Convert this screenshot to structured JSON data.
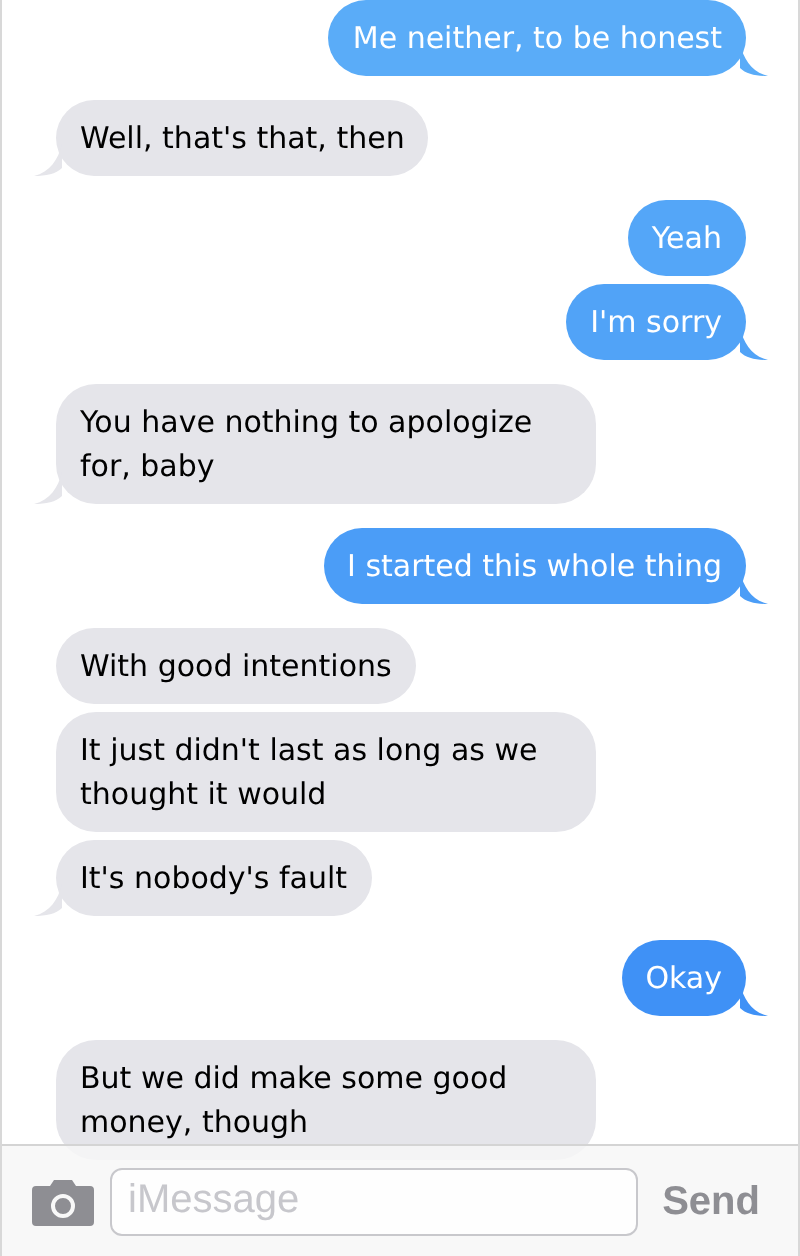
{
  "messages": [
    {
      "text": "Me neither, to be honest",
      "sent": true,
      "tail": true
    },
    {
      "text": "Well, that's that, then",
      "sent": false,
      "tail": true
    },
    {
      "text": "Yeah",
      "sent": true,
      "tail": false
    },
    {
      "text": "I'm sorry",
      "sent": true,
      "tail": true
    },
    {
      "text": "You have nothing to apologize for, baby",
      "sent": false,
      "tail": true
    },
    {
      "text": "I started this whole thing",
      "sent": true,
      "tail": true
    },
    {
      "text": "With good intentions",
      "sent": false,
      "tail": false
    },
    {
      "text": "It just didn't last as long as we thought it would",
      "sent": false,
      "tail": false
    },
    {
      "text": "It's nobody's fault",
      "sent": false,
      "tail": true
    },
    {
      "text": "Okay",
      "sent": true,
      "tail": true
    },
    {
      "text": "But we did make some good money, though",
      "sent": false,
      "tail": false
    }
  ],
  "composer": {
    "placeholder": "iMessage",
    "send": "Send"
  }
}
